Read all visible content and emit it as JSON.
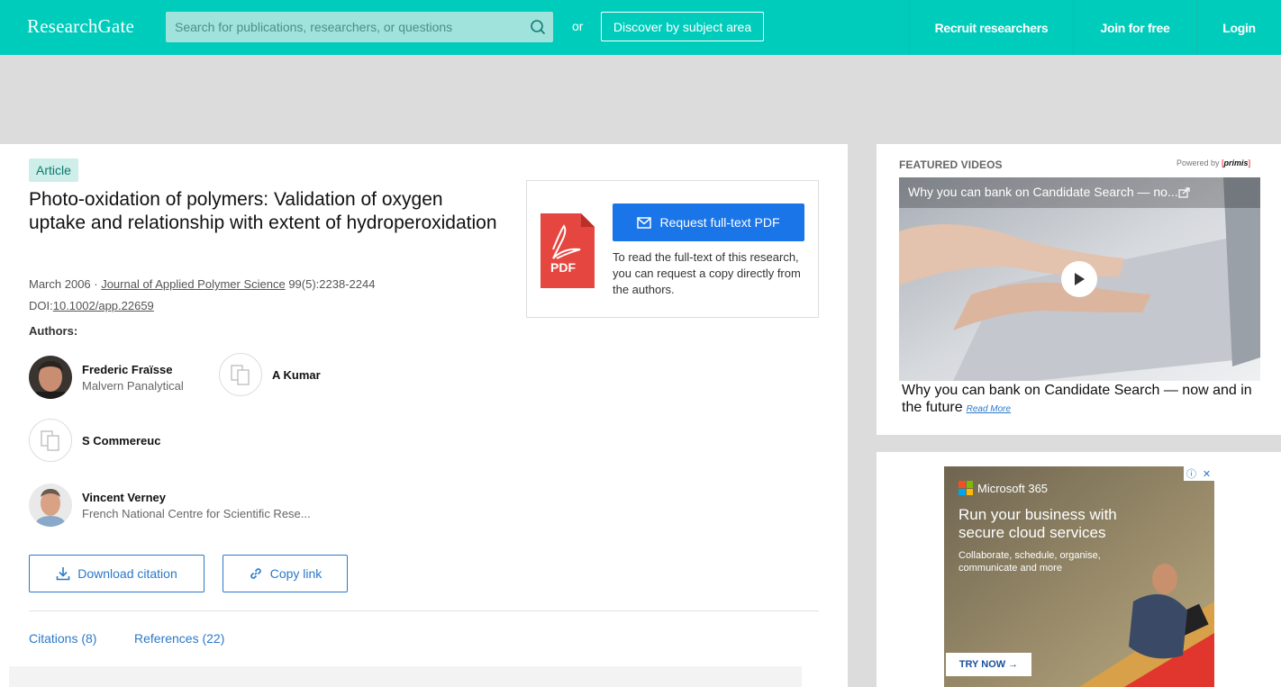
{
  "header": {
    "logo": "ResearchGate",
    "search_placeholder": "Search for publications, researchers, or questions",
    "or_text": "or",
    "discover_label": "Discover by subject area",
    "nav": {
      "recruit": "Recruit researchers",
      "join": "Join for free",
      "login": "Login"
    },
    "brand_color": "#00ccbb"
  },
  "article": {
    "badge": "Article",
    "title": "Photo-oxidation of polymers: Validation of oxygen uptake and relationship with extent of hydroperoxidation",
    "date": "March 2006 · ",
    "journal": "Journal of Applied Polymer Science",
    "volume": " 99(5):2238-2244",
    "doi_label": "DOI:",
    "doi": "10.1002/app.22659",
    "authors_label": "Authors:",
    "authors": [
      {
        "name": "Frederic Fraïsse",
        "affiliation": "Malvern Panalytical"
      },
      {
        "name": "A Kumar",
        "affiliation": ""
      },
      {
        "name": "S Commereuc",
        "affiliation": ""
      },
      {
        "name": "Vincent Verney",
        "affiliation": "French National Centre for Scientific Rese..."
      }
    ],
    "download_citation": "Download citation",
    "copy_link": "Copy link",
    "tabs": {
      "citations": "Citations (8)",
      "references": "References (22)"
    }
  },
  "request": {
    "button": "Request full-text PDF",
    "pdf_label": "PDF",
    "text": "To read the full-text of this research, you can request a copy directly from the authors."
  },
  "featured": {
    "label": "FEATURED VIDEOS",
    "powered_by": "Powered by ",
    "provider": "primis",
    "video_title": "Why you can bank on Candidate Search — no...",
    "caption": "Why you can bank on Candidate Search — now and in the future",
    "read_more": "Read More"
  },
  "ad": {
    "brand": "Microsoft 365",
    "headline": "Run your business with secure cloud services",
    "subtext": "Collaborate, schedule, organise, communicate and more",
    "cta": "TRY NOW →",
    "info_icon": "ⓘ",
    "close_icon": "✕"
  }
}
